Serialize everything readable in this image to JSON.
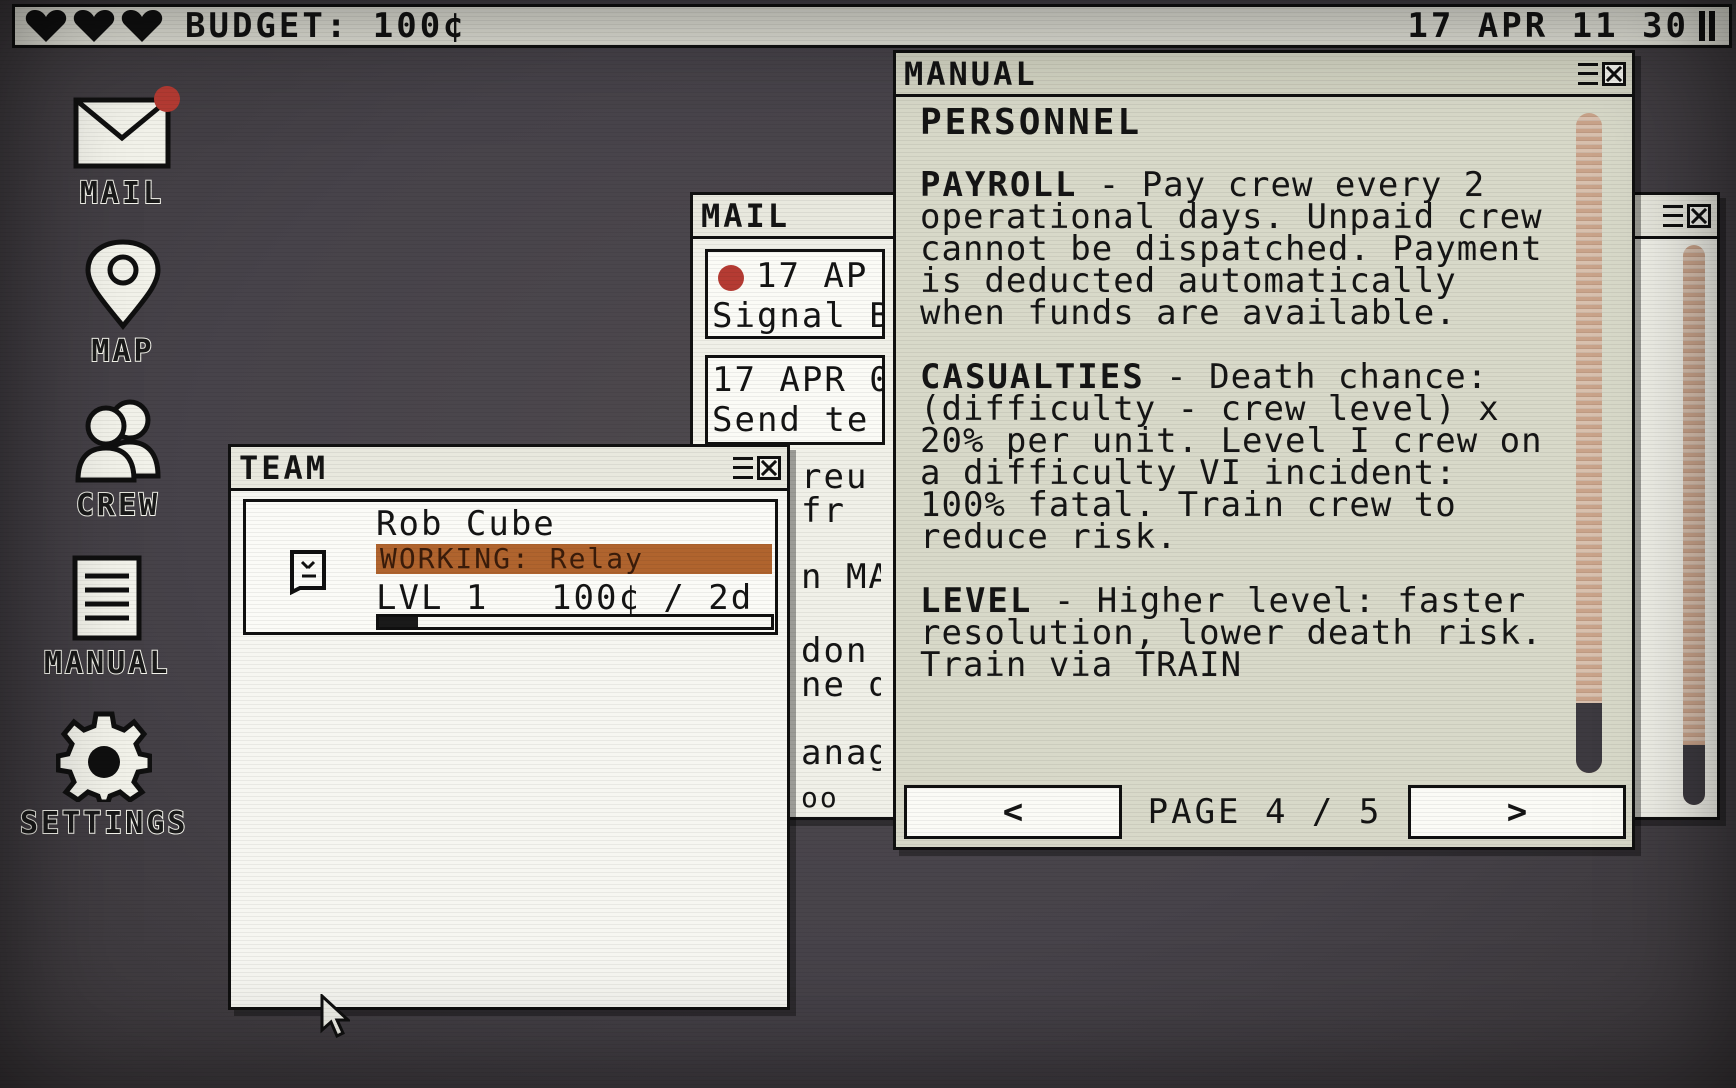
{
  "topbar": {
    "hearts": 3,
    "budget": "BUDGET: 100¢",
    "clock": "17 APR 11 30"
  },
  "desktop": {
    "icons": [
      {
        "label": "MAIL",
        "icon": "envelope-icon",
        "has_notification": true
      },
      {
        "label": "MAP",
        "icon": "map-pin-icon"
      },
      {
        "label": "CREW",
        "icon": "crew-icon"
      },
      {
        "label": "MANUAL",
        "icon": "document-icon"
      },
      {
        "label": "SETTINGS",
        "icon": "gear-icon"
      }
    ]
  },
  "mail": {
    "title": "MAIL",
    "items": [
      {
        "date": "17 AP",
        "subject": "Signal B"
      },
      {
        "date": "17 APR 0",
        "subject": "Send te"
      }
    ],
    "body_fragments": [
      "reu",
      "fr",
      "n MA",
      "don",
      "ne d",
      "anag"
    ],
    "footer_fragment": "oo"
  },
  "team": {
    "title": "TEAM",
    "crew": [
      {
        "name": "Rob Cube",
        "status": "WORKING: Relay",
        "level": "LVL 1",
        "wage": "100¢ / 2d",
        "xp": 0.1
      }
    ]
  },
  "manual": {
    "title": "MANUAL",
    "section": "PERSONNEL",
    "paragraphs": [
      {
        "term": "PAYROLL",
        "text": " - Pay crew every 2 operational days. Unpaid crew cannot be dispatched. Payment is deducted automatically when funds are available."
      },
      {
        "term": "CASUALTIES",
        "text": " - Death chance: (difficulty - crew level) x 20% per unit. Level I crew on a difficulty VI incident: 100% fatal. Train crew to reduce risk."
      },
      {
        "term": "LEVEL",
        "text": " - Higher level: faster resolution, lower death risk. Train via TRAIN"
      }
    ],
    "prev_label": "<",
    "next_label": ">",
    "page_label": "PAGE 4 / 5"
  }
}
